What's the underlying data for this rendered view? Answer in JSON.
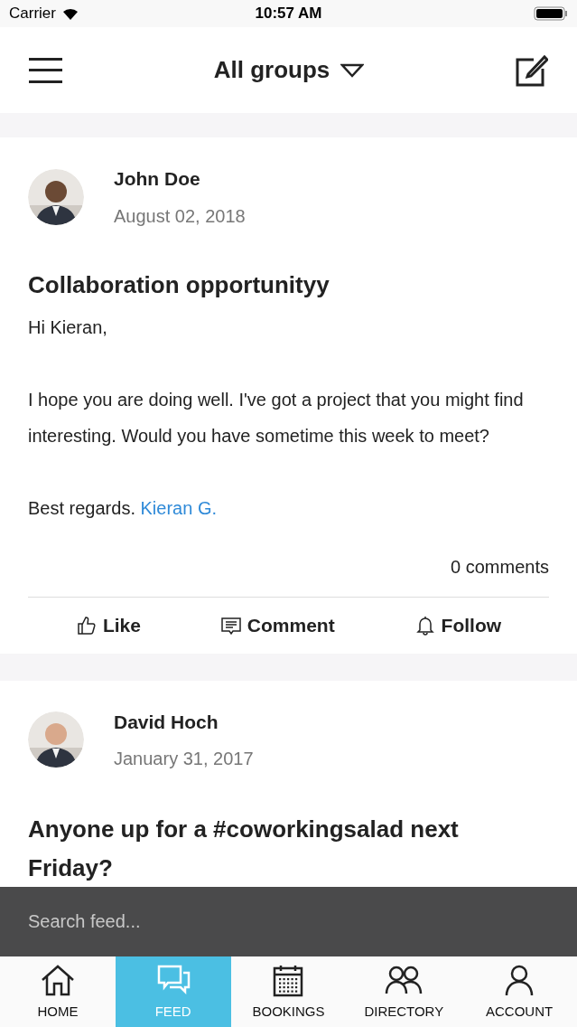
{
  "status_bar": {
    "carrier": "Carrier",
    "time": "10:57 AM"
  },
  "header": {
    "title": "All groups"
  },
  "posts": [
    {
      "author": "John Doe",
      "date": "August 02, 2018",
      "title": "Collaboration opportunityy",
      "paragraphs": [
        "Hi Kieran,",
        "I hope you are doing well. I've got a project that you might find interesting. Would you have sometime this week to meet?"
      ],
      "signoff": "Best regards.",
      "signoff_link": "Kieran G.",
      "comments": "0 comments",
      "actions": [
        {
          "kind": "like",
          "label": "Like"
        },
        {
          "kind": "comment",
          "label": "Comment"
        },
        {
          "kind": "follow",
          "label": "Follow"
        }
      ]
    },
    {
      "author": "David Hoch",
      "date": "January 31, 2017",
      "title": "Anyone up for a #coworkingsalad next Friday?"
    }
  ],
  "search": {
    "placeholder": "Search feed..."
  },
  "tabs": [
    {
      "kind": "home",
      "label": "HOME",
      "selected": false
    },
    {
      "kind": "feed",
      "label": "FEED",
      "selected": true
    },
    {
      "kind": "bookings",
      "label": "BOOKINGS",
      "selected": false
    },
    {
      "kind": "directory",
      "label": "DIRECTORY",
      "selected": false
    },
    {
      "kind": "account",
      "label": "ACCOUNT",
      "selected": false
    }
  ]
}
